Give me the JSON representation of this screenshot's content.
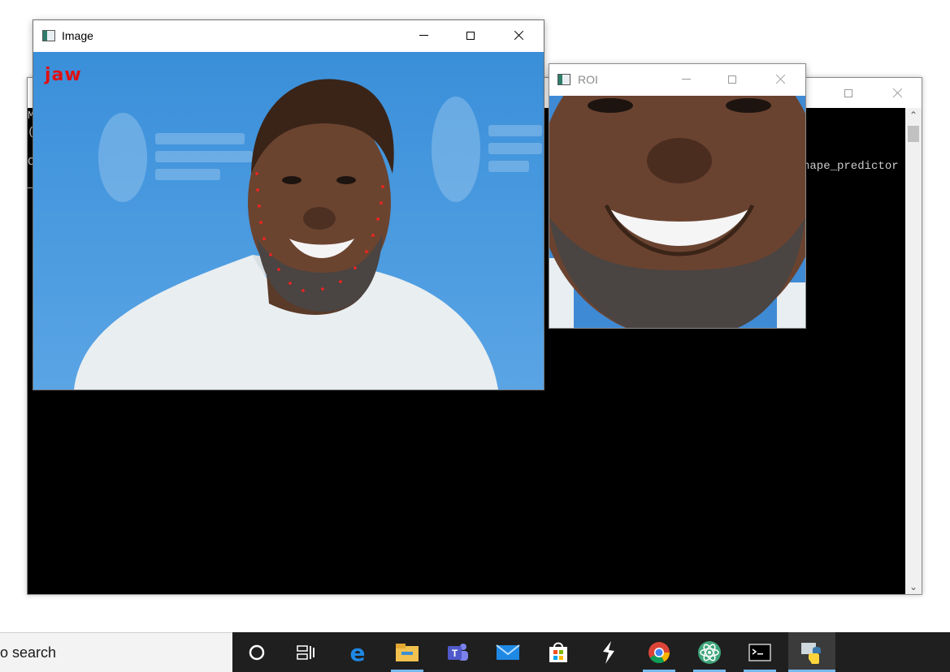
{
  "console": {
    "line1": "M",
    "line2": "(",
    "line3": "C",
    "right_text": "hape_predictor"
  },
  "image_window": {
    "title": "Image",
    "overlay_label": "jaw",
    "overlay_color": "#e01010"
  },
  "roi_window": {
    "title": "ROI"
  },
  "taskbar": {
    "search_text": "o search",
    "items": [
      {
        "icon": "cortana-icon"
      },
      {
        "icon": "task-view-icon"
      },
      {
        "icon": "edge-icon"
      },
      {
        "icon": "file-explorer-icon"
      },
      {
        "icon": "teams-icon"
      },
      {
        "icon": "mail-icon"
      },
      {
        "icon": "store-icon"
      },
      {
        "icon": "sublime-icon"
      },
      {
        "icon": "chrome-icon"
      },
      {
        "icon": "atom-icon"
      },
      {
        "icon": "terminal-icon"
      },
      {
        "icon": "python-icon"
      }
    ]
  },
  "colors": {
    "image_background": "#3a8fd9",
    "taskbar": "#1f1f1f",
    "active_underline": "#76b9ed"
  }
}
